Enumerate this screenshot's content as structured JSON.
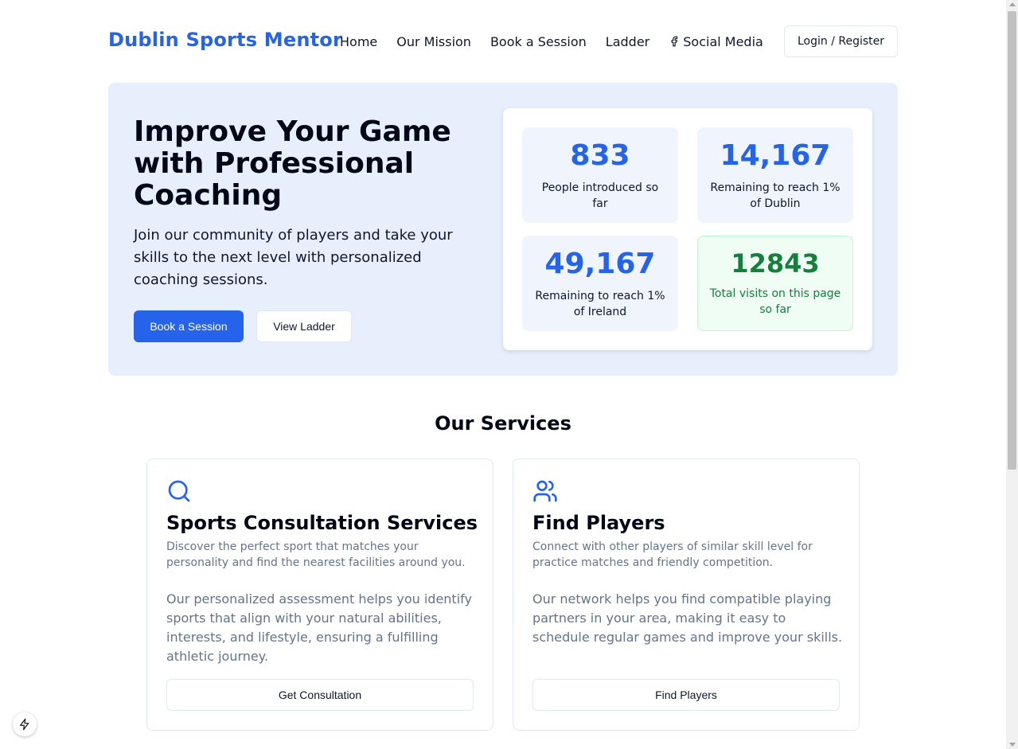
{
  "header": {
    "brand": "Dublin Sports Mentor",
    "nav": [
      "Home",
      "Our Mission",
      "Book a Session",
      "Ladder",
      "Social Media"
    ],
    "login_label": "Login / Register"
  },
  "hero": {
    "title": "Improve Your Game with Professional Coaching",
    "subtitle": "Join our community of players and take your skills to the next level with personalized coaching sessions.",
    "primary_button": "Book a Session",
    "secondary_button": "View Ladder"
  },
  "stats": [
    {
      "value": "833",
      "label": "People introduced so far"
    },
    {
      "value": "14,167",
      "label": "Remaining to reach 1% of Dublin"
    },
    {
      "value": "49,167",
      "label": "Remaining to reach 1% of Ireland"
    },
    {
      "value": "12843",
      "label": "Total visits on this page so far"
    }
  ],
  "services": {
    "heading": "Our Services",
    "cards": [
      {
        "icon": "search-icon",
        "title": "Sports Consultation Services",
        "description": "Discover the perfect sport that matches your personality and find the nearest facilities around you.",
        "body": "Our personalized assessment helps you identify sports that align with your natural abilities, interests, and lifestyle, ensuring a fulfilling athletic journey.",
        "button": "Get Consultation"
      },
      {
        "icon": "users-icon",
        "title": "Find Players",
        "description": "Connect with other players of similar skill level for practice matches and friendly competition.",
        "body": "Our network helps you find compatible playing partners in your area, making it easy to schedule regular games and improve your skills.",
        "button": "Find Players"
      }
    ]
  },
  "colors": {
    "accent": "#2563eb",
    "hero_bg": "#e8effc",
    "stat_bg": "#eff4fd",
    "success": "#15803d",
    "success_bg": "#f0fdf4",
    "muted_text": "#64748b"
  }
}
